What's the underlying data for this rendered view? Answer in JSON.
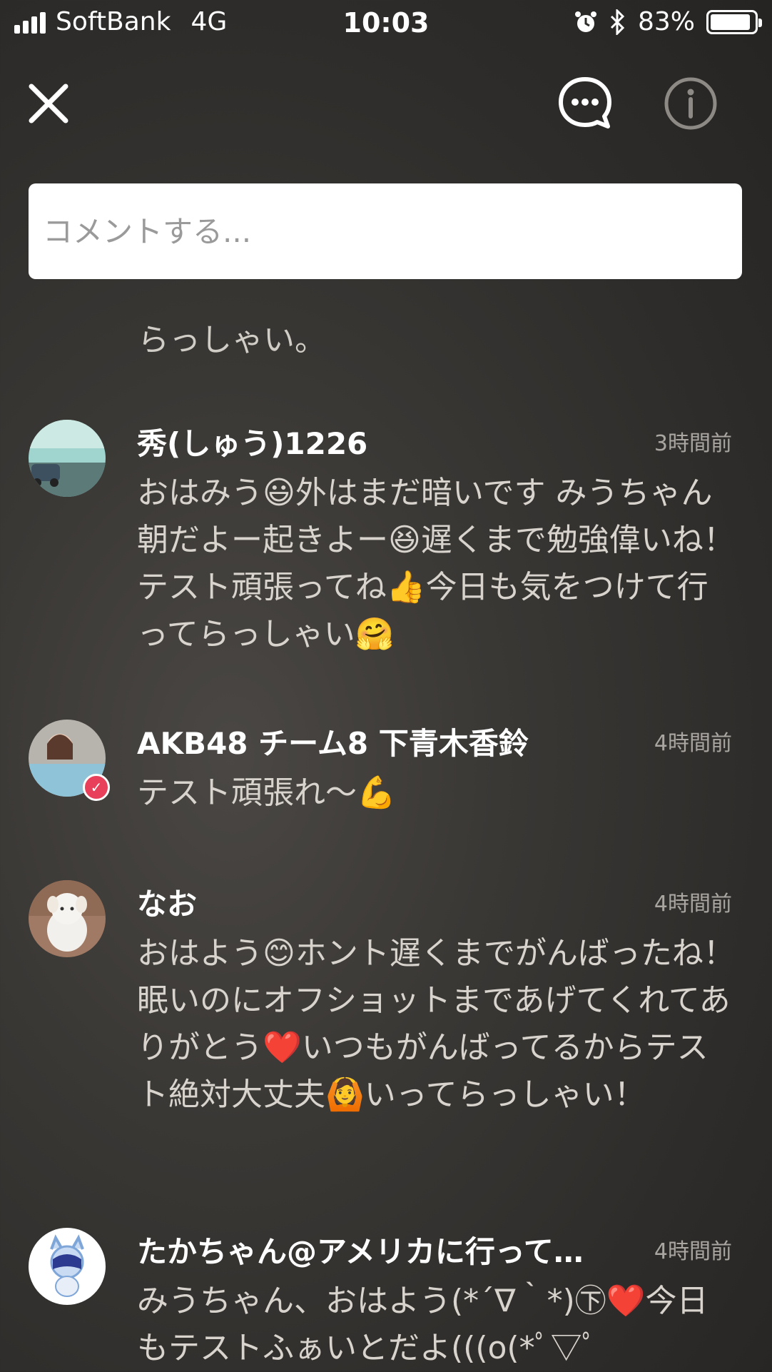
{
  "status_bar": {
    "carrier": "SoftBank",
    "network": "4G",
    "time": "10:03",
    "alarm_icon": "alarm-icon",
    "bluetooth_icon": "bluetooth-icon",
    "battery": "83%"
  },
  "header": {
    "close_icon": "close-icon",
    "comment_icon": "comment-bubble-icon",
    "info_icon": "info-icon"
  },
  "comment_input": {
    "placeholder": "コメントする..."
  },
  "previous_tail": "らっしゃい。",
  "comments": [
    {
      "user": "秀(しゅう)1226",
      "time": "3時間前",
      "text": "おはみう😃外はまだ暗いです みうちゃん朝だよー起きよー😆遅くまで勉強偉いね！テスト頑張ってね👍今日も気をつけて行ってらっしゃい🤗"
    },
    {
      "user": "AKB48 チーム8 下青木香鈴",
      "time": "4時間前",
      "text": "テスト頑張れ〜💪",
      "verified": true
    },
    {
      "user": "なお",
      "time": "4時間前",
      "text": "おはよう😊ホント遅くまでがんばったね！眠いのにオフショットまであげてくれてありがとう❤️いつもがんばってるからテスト絶対大丈夫🙆いってらっしゃい！"
    },
    {
      "user": "たかちゃん@アメリカに行って…",
      "time": "4時間前",
      "text": "みうちゃん、おはよう(*´∇｀*)㊦❤️今日もテストふぁいとだよ(((o(*ﾟ▽ﾟ"
    }
  ],
  "colors": {
    "background": "#34322f",
    "text_secondary": "#d8d4cd",
    "time": "#a9a6a1",
    "verified_badge": "#e8405a"
  }
}
